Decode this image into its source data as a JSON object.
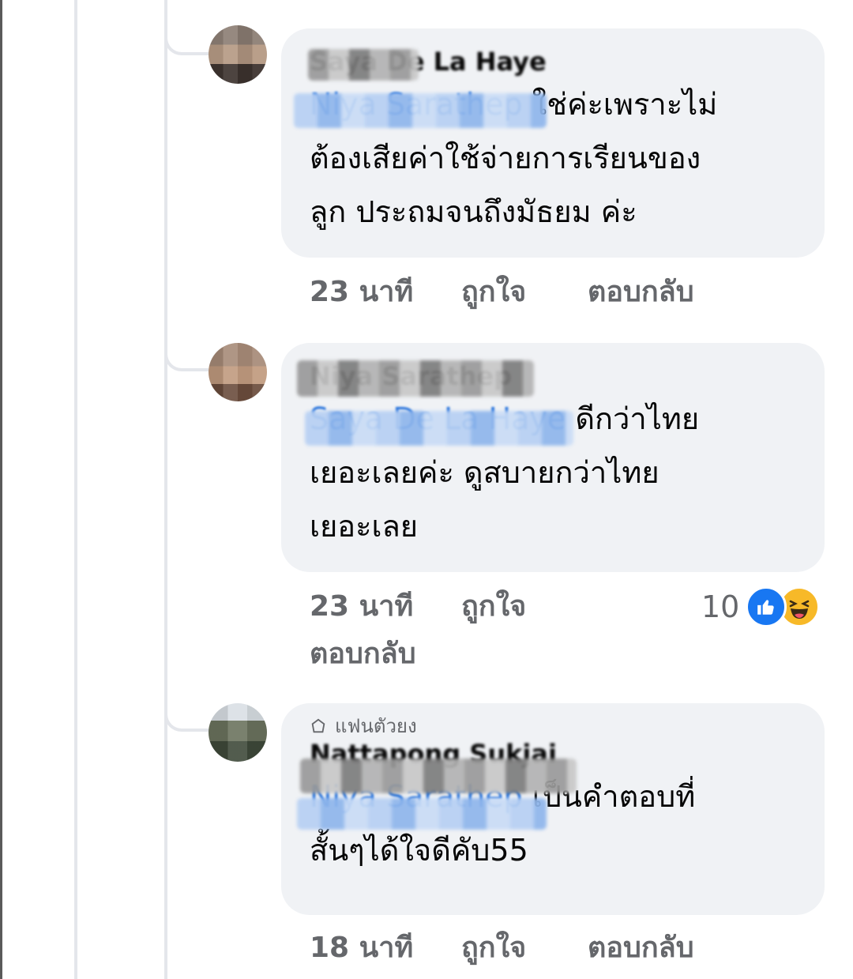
{
  "comments": [
    {
      "author": "Saya De La Haye",
      "mention": "Niya Sarathep",
      "text_lines": [
        "ใช่ค่ะเพราะไม่",
        "ต้องเสียค่าใช้จ่ายการเรียนของ",
        "ลูก ประถมจนถึงมัธยม ค่ะ"
      ],
      "time": "23 นาที",
      "like_label": "ถูกใจ",
      "reply_label": "ตอบกลับ"
    },
    {
      "author": "Niya Sarathep",
      "mention": "Saya De La Haye",
      "text_lines": [
        "ดีกว่าไทย",
        "เยอะเลยค่ะ ดูสบายกว่าไทย",
        "เยอะเลย"
      ],
      "time": "23 นาที",
      "like_label": "ถูกใจ",
      "reply_label": "ตอบกลับ",
      "reaction_count": "10",
      "reaction_icons": [
        "like-icon",
        "haha-icon"
      ]
    },
    {
      "badge": "แฟนตัวยง",
      "badge_icon": "fan-badge-icon",
      "author": "Nattapong Sukjai",
      "mention": "Niya Sarathep",
      "text_lines": [
        "เป็นคำตอบที่",
        "สั้นๆได้ใจดีคับ55"
      ],
      "time": "18 นาที",
      "like_label": "ถูกใจ",
      "reply_label": "ตอบกลับ"
    }
  ],
  "colors": {
    "bubble": "#f0f2f5",
    "mention": "#216fdb",
    "meta": "#65676b",
    "like": "#1877f2",
    "haha": "#f7b928"
  }
}
